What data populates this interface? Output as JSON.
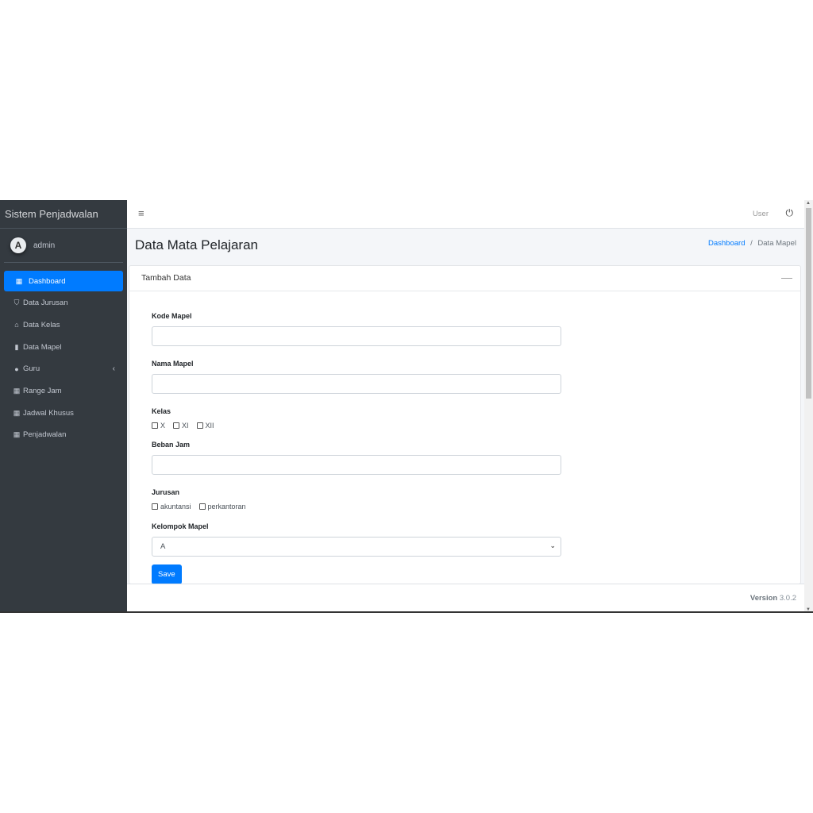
{
  "brand": "Sistem Penjadwalan",
  "user": {
    "avatar_letter": "A",
    "name": "admin"
  },
  "sidebar": {
    "items": [
      {
        "label": "Dashboard",
        "icon": "th-icon",
        "glyph": "▦",
        "active": true
      },
      {
        "label": "Data Jurusan",
        "icon": "shield-icon",
        "glyph": "⛉"
      },
      {
        "label": "Data Kelas",
        "icon": "school-icon",
        "glyph": "⌂"
      },
      {
        "label": "Data Mapel",
        "icon": "book-open-icon",
        "glyph": "▮"
      },
      {
        "label": "Guru",
        "icon": "user-icon",
        "glyph": "●",
        "chevron": "‹"
      },
      {
        "label": "Range Jam",
        "icon": "table-icon",
        "glyph": "▦"
      },
      {
        "label": "Jadwal Khusus",
        "icon": "table-icon",
        "glyph": "▦"
      },
      {
        "label": "Penjadwalan",
        "icon": "table-icon",
        "glyph": "▦"
      }
    ]
  },
  "topnav": {
    "menu_glyph": "≡",
    "user_label": "User",
    "power_glyph": "⏻"
  },
  "header": {
    "title": "Data Mata Pelajaran",
    "breadcrumb": [
      "Dashboard",
      "Data Mapel"
    ],
    "separator": "/"
  },
  "card": {
    "title": "Tambah Data",
    "collapse_glyph": "—"
  },
  "form": {
    "kode_label": "Kode Mapel",
    "kode_value": "",
    "nama_label": "Nama Mapel",
    "nama_value": "",
    "kelas_label": "Kelas",
    "kelas_options": [
      "X",
      "XI",
      "XII"
    ],
    "beban_label": "Beban Jam",
    "beban_value": "",
    "jurusan_label": "Jurusan",
    "jurusan_options": [
      "akuntansi",
      "perkantoran"
    ],
    "kelompok_label": "Kelompok Mapel",
    "kelompok_value": "A",
    "save_label": "Save"
  },
  "footer": {
    "version_label": "Version",
    "version": "3.0.2"
  },
  "colors": {
    "primary": "#007bff",
    "sidebar": "#343a40",
    "content_bg": "#f4f6f9"
  }
}
